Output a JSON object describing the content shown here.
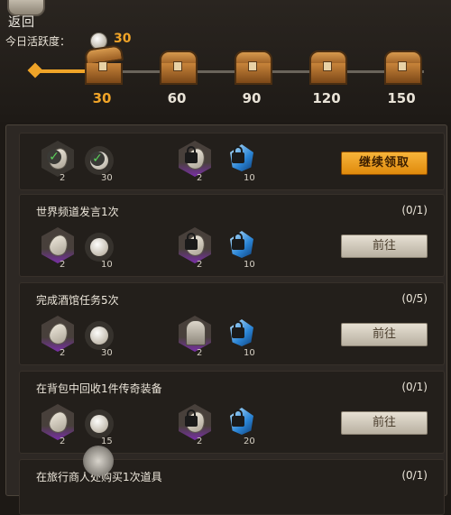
{
  "header": {
    "back_label": "返回",
    "activity_label": "今日活跃度：",
    "activity_value": "30"
  },
  "milestones": [
    {
      "value": "30",
      "active": true
    },
    {
      "value": "60",
      "active": false
    },
    {
      "value": "90",
      "active": false
    },
    {
      "value": "120",
      "active": false
    },
    {
      "value": "150",
      "active": false
    }
  ],
  "tasks": [
    {
      "title": "",
      "progress": "",
      "rewards_left": [
        {
          "icon": "leaf-token-icon",
          "count": "2",
          "checked": true
        },
        {
          "icon": "coin-icon",
          "count": "30",
          "checked": true
        }
      ],
      "rewards_right": [
        {
          "icon": "leaf-token-icon",
          "count": "2"
        },
        {
          "icon": "blue-crystal-icon",
          "count": "10"
        }
      ],
      "button": "继续领取"
    },
    {
      "title": "世界频道发言1次",
      "progress": "(0/1)",
      "rewards_left": [
        {
          "icon": "leaf-token-icon",
          "count": "2"
        },
        {
          "icon": "coin-icon",
          "count": "10"
        }
      ],
      "rewards_right": [
        {
          "icon": "leaf-token-icon",
          "count": "2"
        },
        {
          "icon": "blue-crystal-icon",
          "count": "10"
        }
      ],
      "button": "前往"
    },
    {
      "title": "完成酒馆任务5次",
      "progress": "(0/5)",
      "rewards_left": [
        {
          "icon": "leaf-token-icon",
          "count": "2"
        },
        {
          "icon": "coin-icon",
          "count": "30"
        }
      ],
      "rewards_right": [
        {
          "icon": "tombstone-icon",
          "count": "2"
        },
        {
          "icon": "blue-crystal-icon",
          "count": "10"
        }
      ],
      "button": "前往"
    },
    {
      "title": "在背包中回收1件传奇装备",
      "progress": "(0/1)",
      "rewards_left": [
        {
          "icon": "leaf-token-icon",
          "count": "2"
        },
        {
          "icon": "coin-icon",
          "count": "15"
        }
      ],
      "rewards_right": [
        {
          "icon": "leaf-token-icon",
          "count": "2"
        },
        {
          "icon": "blue-crystal-icon",
          "count": "20"
        }
      ],
      "button": "前往"
    },
    {
      "title": "在旅行商人处购买1次道具",
      "progress": "(0/1)"
    }
  ]
}
